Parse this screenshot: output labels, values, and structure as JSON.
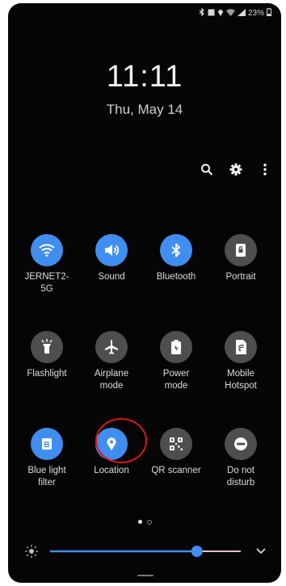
{
  "status_bar": {
    "battery_text": "23%",
    "icons": [
      "bluetooth-icon",
      "image-icon",
      "location-icon",
      "wifi-icon",
      "signal-icon",
      "battery-icon"
    ]
  },
  "clock": {
    "time": "11:11",
    "date": "Thu, May 14"
  },
  "top_actions": [
    "search-icon",
    "gear-icon",
    "more-vert-icon"
  ],
  "tiles": [
    {
      "label": "JERNET2-\n5G",
      "icon": "wifi-icon",
      "state": "on"
    },
    {
      "label": "Sound",
      "icon": "sound-icon",
      "state": "on"
    },
    {
      "label": "Bluetooth",
      "icon": "bluetooth-icon",
      "state": "on"
    },
    {
      "label": "Portrait",
      "icon": "portrait-lock-icon",
      "state": "off"
    },
    {
      "label": "Flashlight",
      "icon": "flashlight-icon",
      "state": "off"
    },
    {
      "label": "Airplane\nmode",
      "icon": "airplane-icon",
      "state": "off"
    },
    {
      "label": "Power\nmode",
      "icon": "power-mode-icon",
      "state": "off"
    },
    {
      "label": "Mobile\nHotspot",
      "icon": "hotspot-icon",
      "state": "off"
    },
    {
      "label": "Blue light\nfilter",
      "icon": "blue-light-icon",
      "state": "on"
    },
    {
      "label": "Location",
      "icon": "location-icon",
      "state": "on"
    },
    {
      "label": "QR scanner",
      "icon": "qr-icon",
      "state": "off"
    },
    {
      "label": "Do not\ndisturb",
      "icon": "do-not-disturb-icon",
      "state": "off"
    }
  ],
  "pager": {
    "pages": 2,
    "current": 1
  },
  "brightness": {
    "level": 0.77
  },
  "colors": {
    "accent": "#3f8ef0",
    "off_tile": "#4e4e4e",
    "highlight": "#e01414"
  }
}
